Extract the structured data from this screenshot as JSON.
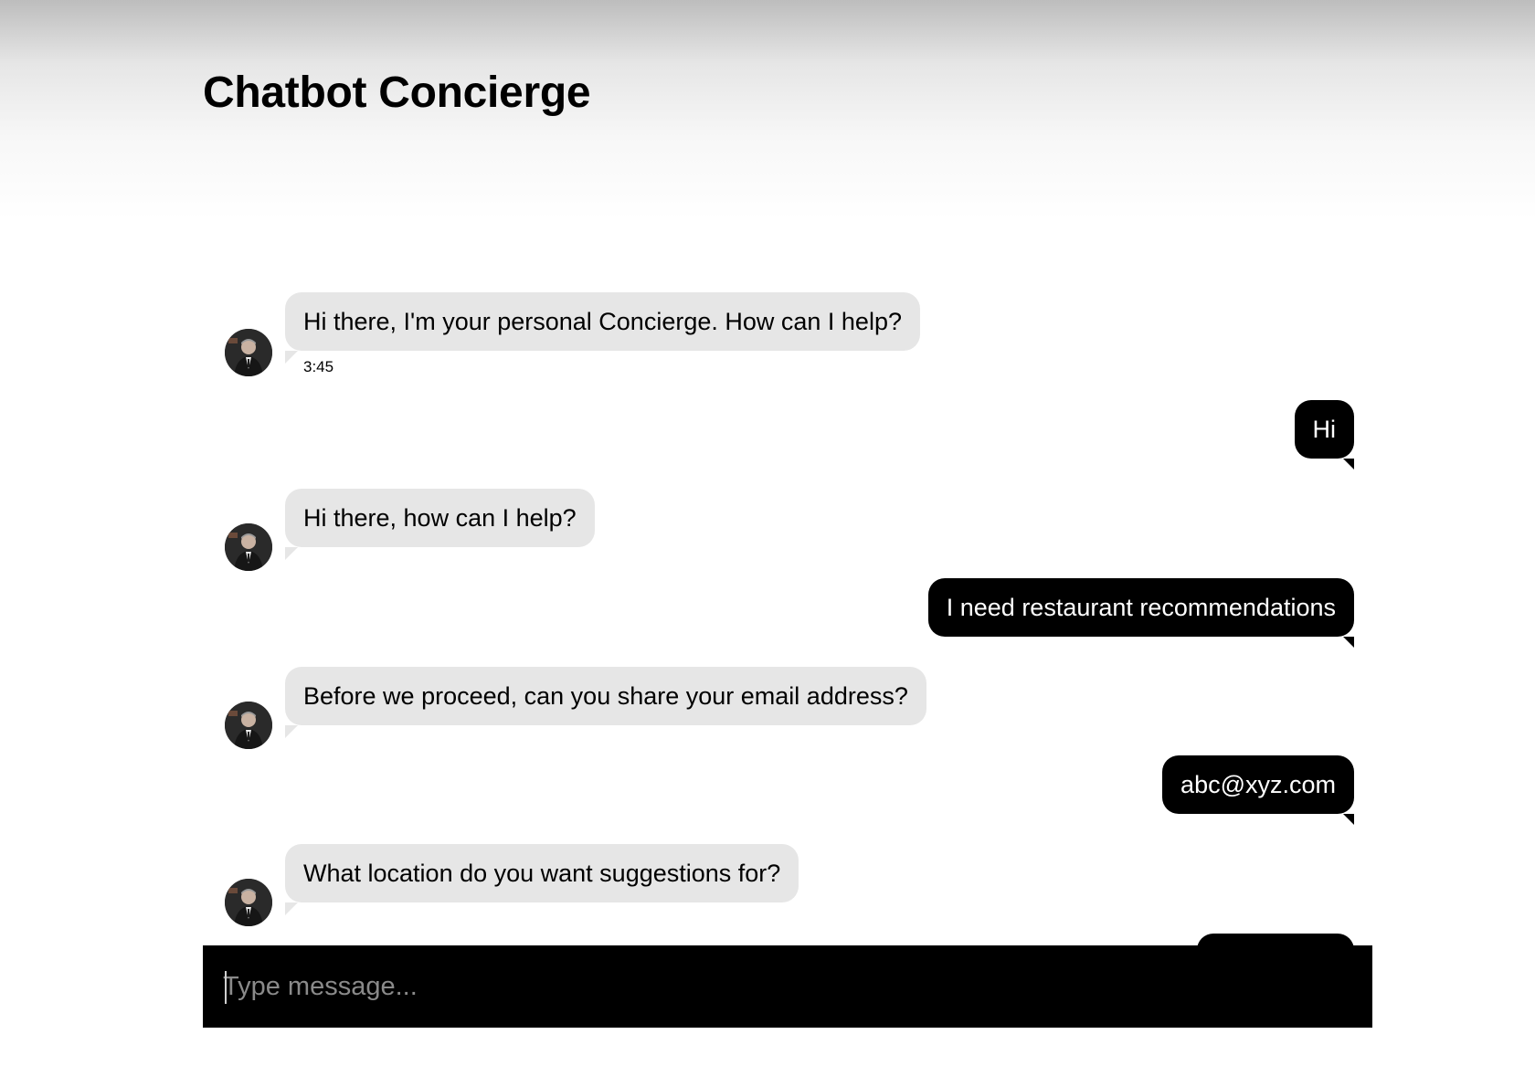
{
  "app": {
    "title": "Chatbot Concierge"
  },
  "messages": [
    {
      "sender": "bot",
      "text": "Hi there, I'm your personal Concierge. How can I help?",
      "time": "3:45"
    },
    {
      "sender": "user",
      "text": "Hi"
    },
    {
      "sender": "bot",
      "text": "Hi there, how can I help?"
    },
    {
      "sender": "user",
      "text": "I need restaurant recommendations"
    },
    {
      "sender": "bot",
      "text": "Before we proceed, can you share your email address?"
    },
    {
      "sender": "user",
      "text": "abc@xyz.com"
    },
    {
      "sender": "bot",
      "text": "What location do you want suggestions for?"
    },
    {
      "sender": "user",
      "text": ""
    }
  ],
  "composer": {
    "placeholder": "Type message..."
  },
  "colors": {
    "bot_bubble": "#e6e6e6",
    "user_bubble": "#000000",
    "composer_bg": "#000000"
  },
  "icons": {
    "avatar": "concierge-avatar-icon"
  }
}
